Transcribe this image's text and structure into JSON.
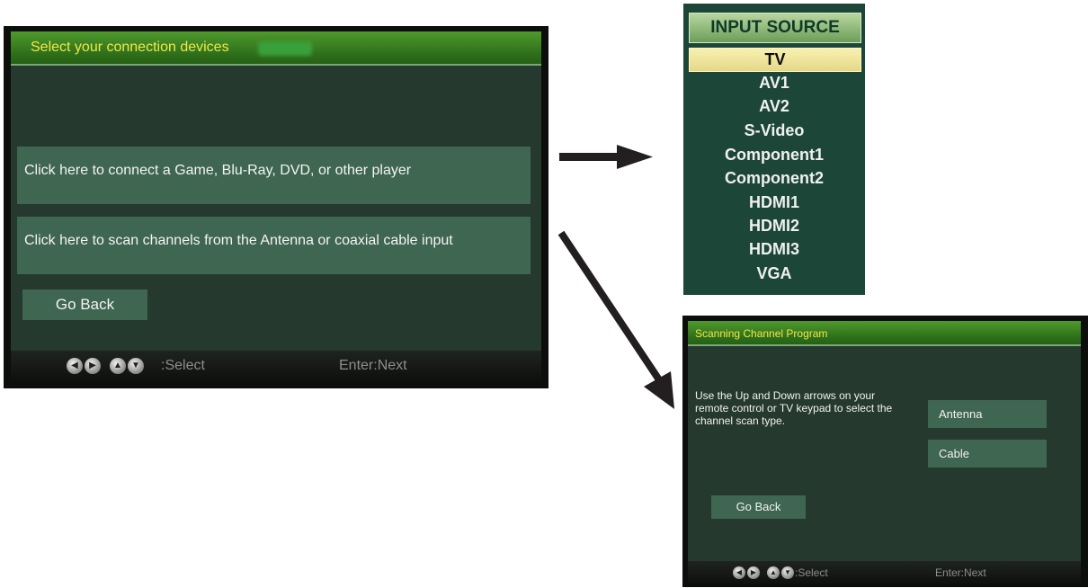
{
  "connection_panel": {
    "title": "Select your connection devices",
    "option_player": "Click here to connect a Game, Blu-Ray, DVD, or other player",
    "option_scan": "Click here to scan channels from the Antenna or coaxial cable input",
    "go_back": "Go Back",
    "footer_select": ":Select",
    "footer_next": "Enter:Next"
  },
  "input_source": {
    "title": "INPUT SOURCE",
    "items": [
      "TV",
      "AV1",
      "AV2",
      "S-Video",
      "Component1",
      "Component2",
      "HDMI1",
      "HDMI2",
      "HDMI3",
      "VGA"
    ],
    "active": "TV"
  },
  "scan_panel": {
    "title": "Scanning Channel Program",
    "instructions": "Use the Up and Down arrows on your remote control or TV keypad to select the channel scan type.",
    "antenna": "Antenna",
    "cable": "Cable",
    "go_back": "Go Back",
    "footer_select": ":Select",
    "footer_next": "Enter:Next"
  },
  "icons": {
    "nav": [
      "left-arrow-icon",
      "right-arrow-icon",
      "up-arrow-icon",
      "down-arrow-icon"
    ]
  },
  "colors": {
    "panel_bg": "#25392e",
    "header_green": "#2e6f1a",
    "title_yellow": "#f0e64a",
    "option_bg": "#3f6650",
    "arrow": "#231f20"
  }
}
